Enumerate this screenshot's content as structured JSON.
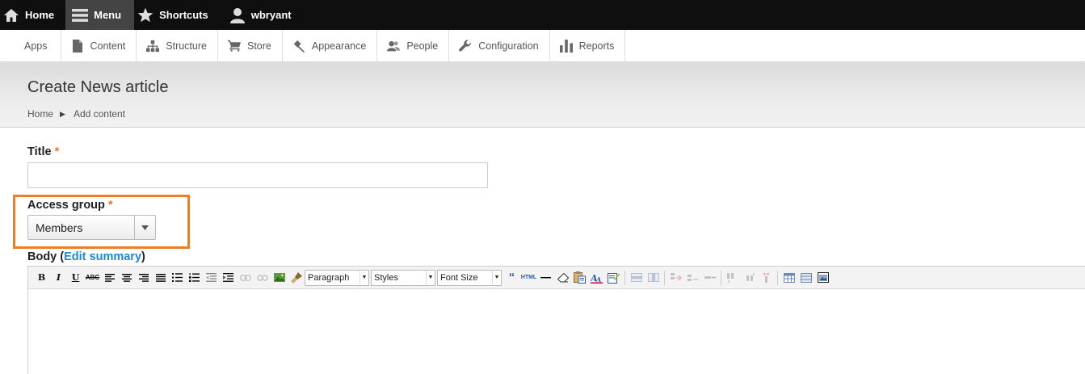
{
  "toolbar": {
    "items": [
      {
        "label": "Home",
        "icon": "home-icon"
      },
      {
        "label": "Menu",
        "icon": "menu-icon",
        "active": true
      },
      {
        "label": "Shortcuts",
        "icon": "star-icon"
      },
      {
        "label": "wbryant",
        "icon": "user-icon"
      }
    ]
  },
  "tray": {
    "items": [
      {
        "label": "Apps"
      },
      {
        "label": "Content",
        "icon": "file-icon"
      },
      {
        "label": "Structure",
        "icon": "sitemap-icon"
      },
      {
        "label": "Store",
        "icon": "cart-icon"
      },
      {
        "label": "Appearance",
        "icon": "brush-icon"
      },
      {
        "label": "People",
        "icon": "people-icon"
      },
      {
        "label": "Configuration",
        "icon": "wrench-icon"
      },
      {
        "label": "Reports",
        "icon": "bar-chart-icon"
      }
    ]
  },
  "header": {
    "title": "Create News article",
    "breadcrumb": [
      "Home",
      "Add content"
    ]
  },
  "form": {
    "title_label": "Title",
    "required_marker": "*",
    "title_value": "",
    "access_label": "Access group",
    "access_value": "Members",
    "body_label": "Body",
    "body_paren_open": "(",
    "edit_summary": "Edit summary",
    "body_paren_close": ")"
  },
  "editor": {
    "bold": "B",
    "italic": "I",
    "underline": "U",
    "strike": "ABC",
    "format_select": "Paragraph",
    "styles_select": "Styles",
    "fontsize_select": "Font Size",
    "html_label": "HTML"
  },
  "colors": {
    "highlight": "#f07c25",
    "required": "#e8782a",
    "link": "#1f86d1",
    "toolbar_bg": "#0f0f0f"
  }
}
